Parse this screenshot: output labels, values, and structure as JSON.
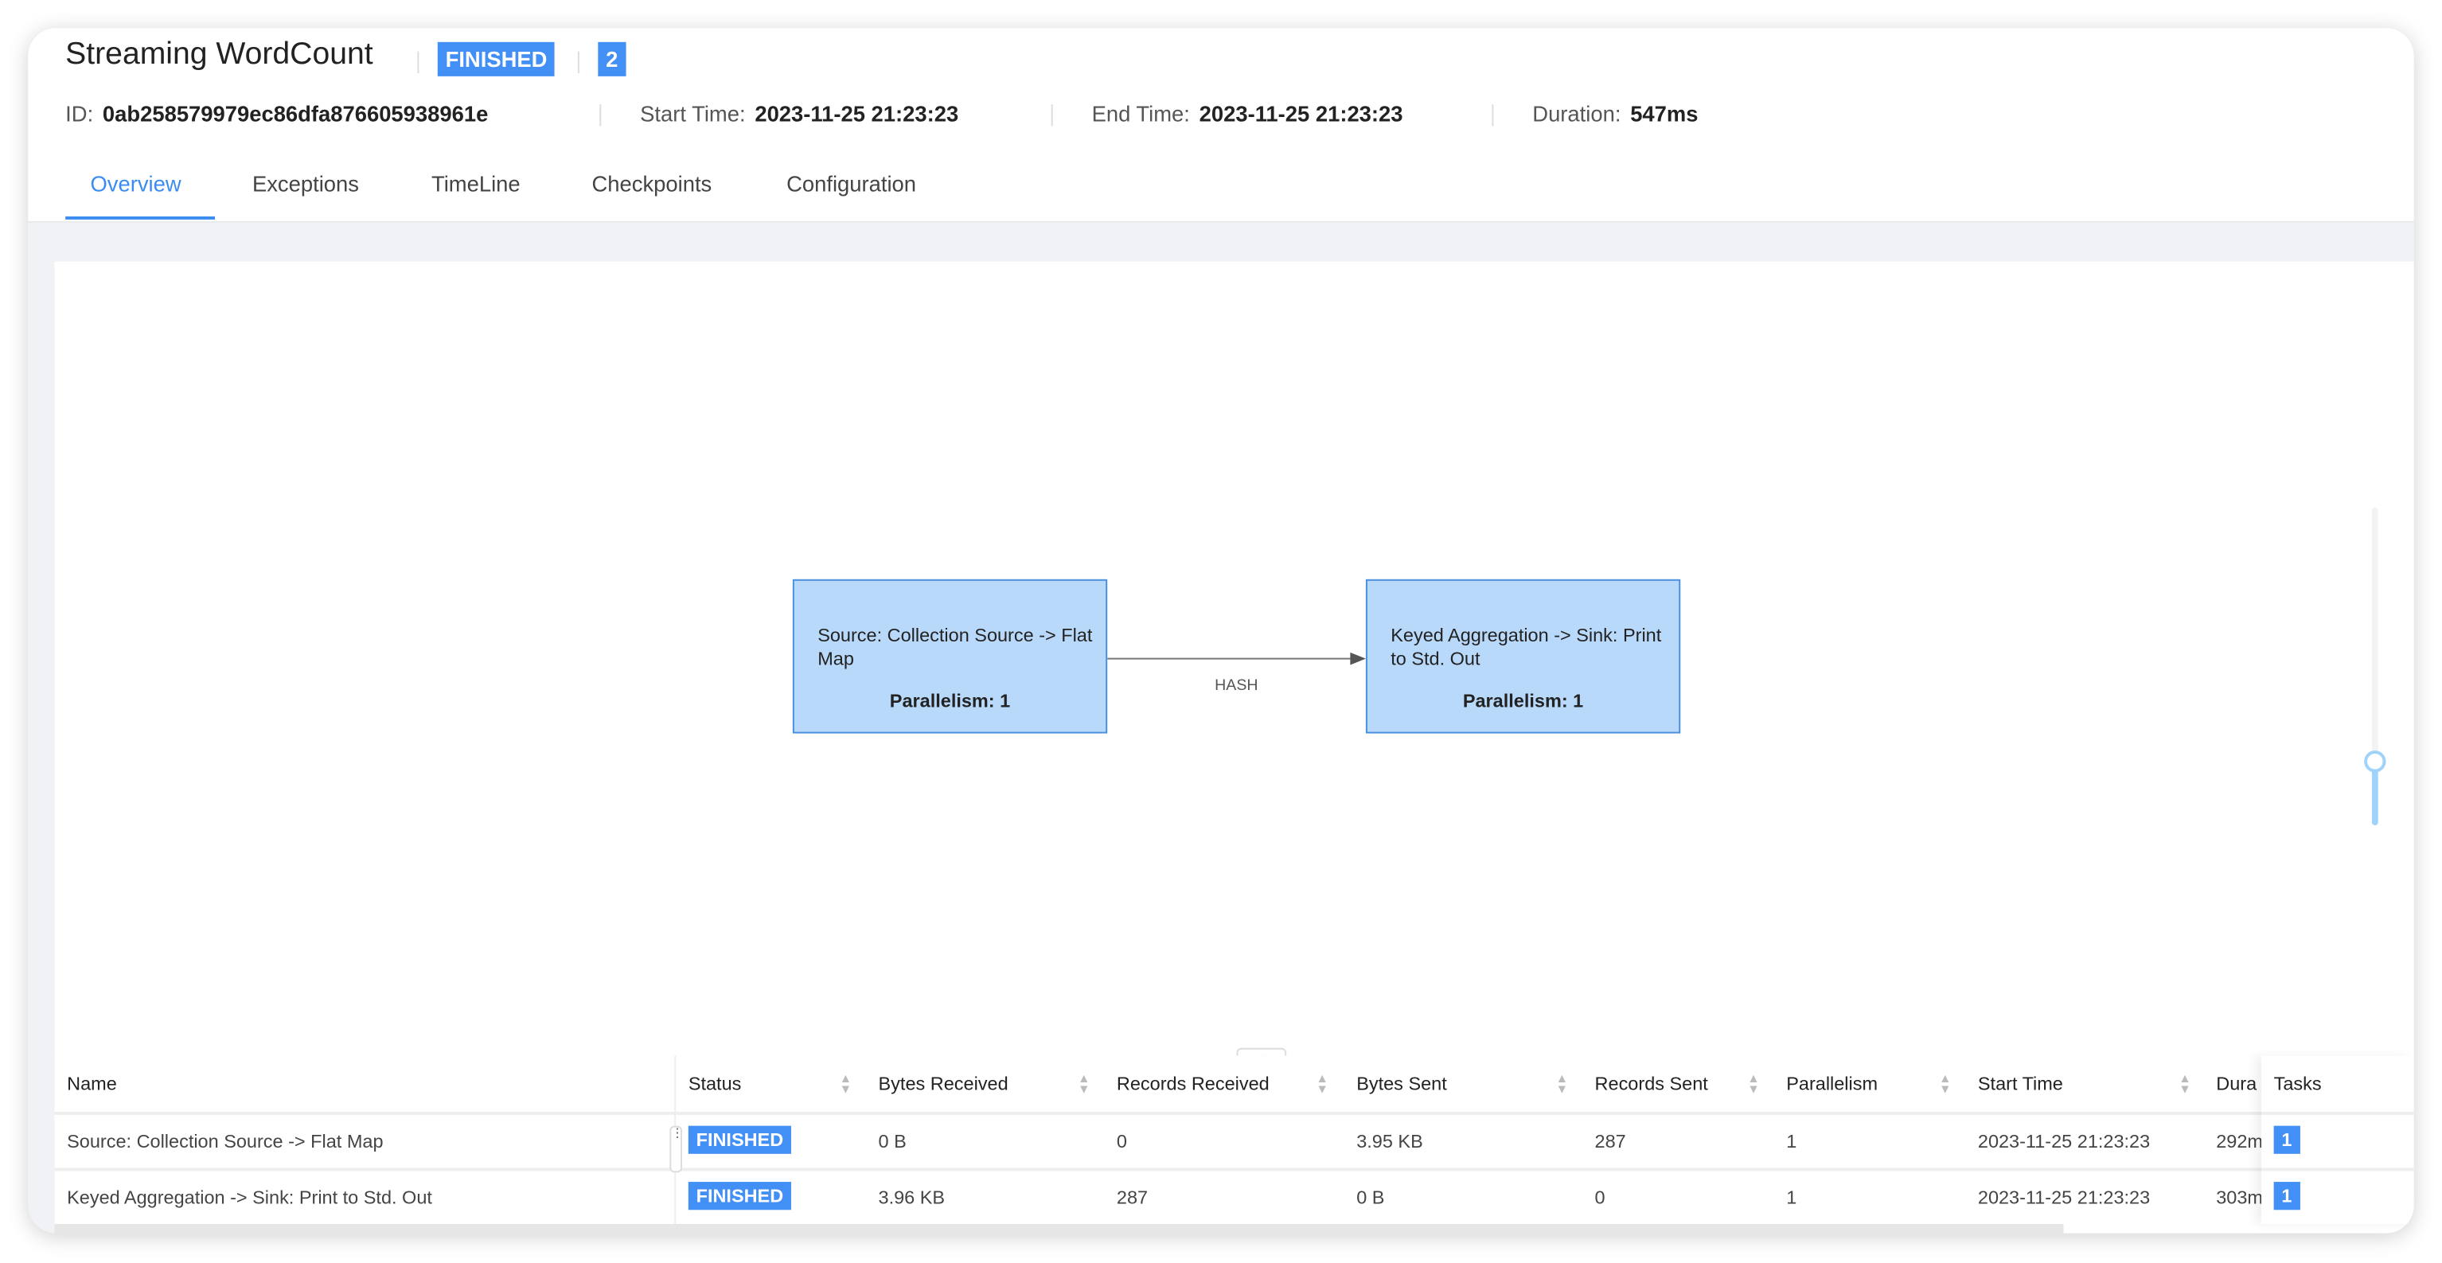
{
  "job": {
    "title": "Streaming WordCount",
    "status": "FINISHED",
    "vertex_count": "2",
    "id_label": "ID:",
    "id": "0ab258579979ec86dfa876605938961e",
    "start_label": "Start Time:",
    "start": "2023-11-25 21:23:23",
    "end_label": "End Time:",
    "end": "2023-11-25 21:23:23",
    "duration_label": "Duration:",
    "duration": "547ms"
  },
  "tabs": [
    {
      "label": "Overview",
      "active": true
    },
    {
      "label": "Exceptions"
    },
    {
      "label": "TimeLine"
    },
    {
      "label": "Checkpoints"
    },
    {
      "label": "Configuration"
    }
  ],
  "graph": {
    "nodes": [
      {
        "name": "Source: Collection Source -> Flat Map",
        "parallelism": "Parallelism: 1"
      },
      {
        "name": "Keyed Aggregation -> Sink: Print to Std. Out",
        "parallelism": "Parallelism: 1"
      }
    ],
    "edge": {
      "label": "HASH"
    },
    "zoom_level": 0.2,
    "resize_handle": "..."
  },
  "table": {
    "columns": [
      "Name",
      "Status",
      "Bytes Received",
      "Records Received",
      "Bytes Sent",
      "Records Sent",
      "Parallelism",
      "Start Time",
      "Dura",
      "Tasks"
    ],
    "rows": [
      [
        "Source: Collection Source -> Flat Map",
        "FINISHED",
        "0 B",
        "0",
        "3.95 KB",
        "287",
        "1",
        "2023-11-25 21:23:23",
        "292m",
        "1"
      ],
      [
        "Keyed Aggregation -> Sink: Print to Std. Out",
        "FINISHED",
        "3.96 KB",
        "287",
        "0 B",
        "0",
        "1",
        "2023-11-25 21:23:23",
        "303m",
        "1"
      ]
    ]
  },
  "colors": {
    "accent": "#3b8cf0",
    "badge": "#4290f5",
    "node_fill": "#b9d9fb",
    "node_border": "#4a90e2"
  }
}
